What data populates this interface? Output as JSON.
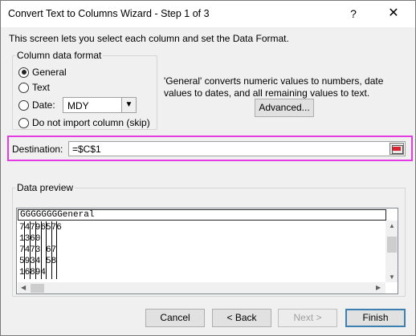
{
  "window": {
    "title": "Convert Text to Columns Wizard - Step 1 of 3",
    "help_label": "?",
    "close_label": "✕"
  },
  "intro_text": "This screen lets you select each column and set the Data Format.",
  "column_format": {
    "title": "Column data format",
    "options": [
      {
        "label": "General",
        "checked": true
      },
      {
        "label": "Text",
        "checked": false
      },
      {
        "label": "Date:",
        "checked": false
      },
      {
        "label": "Do not import column (skip)",
        "checked": false
      }
    ],
    "date_format": "MDY"
  },
  "description": "'General' converts numeric values to numbers, date values to dates, and all remaining values to text.",
  "advanced_label": "Advanced...",
  "destination": {
    "label": "Destination:",
    "value": "=$C$1"
  },
  "preview": {
    "title": "Data preview",
    "header": "GGGGGGGGeneral",
    "rows": [
      "74796576",
      "1360",
      "7473 67",
      "5934 58",
      "16894"
    ],
    "row_first_digits": [
      "7",
      "2",
      "7",
      "2",
      "7"
    ]
  },
  "buttons": {
    "cancel": "Cancel",
    "back": "< Back",
    "next": "Next >",
    "finish": "Finish"
  },
  "colors": {
    "highlight": "#e53be3",
    "default_button_border": "#3c7fb1"
  }
}
